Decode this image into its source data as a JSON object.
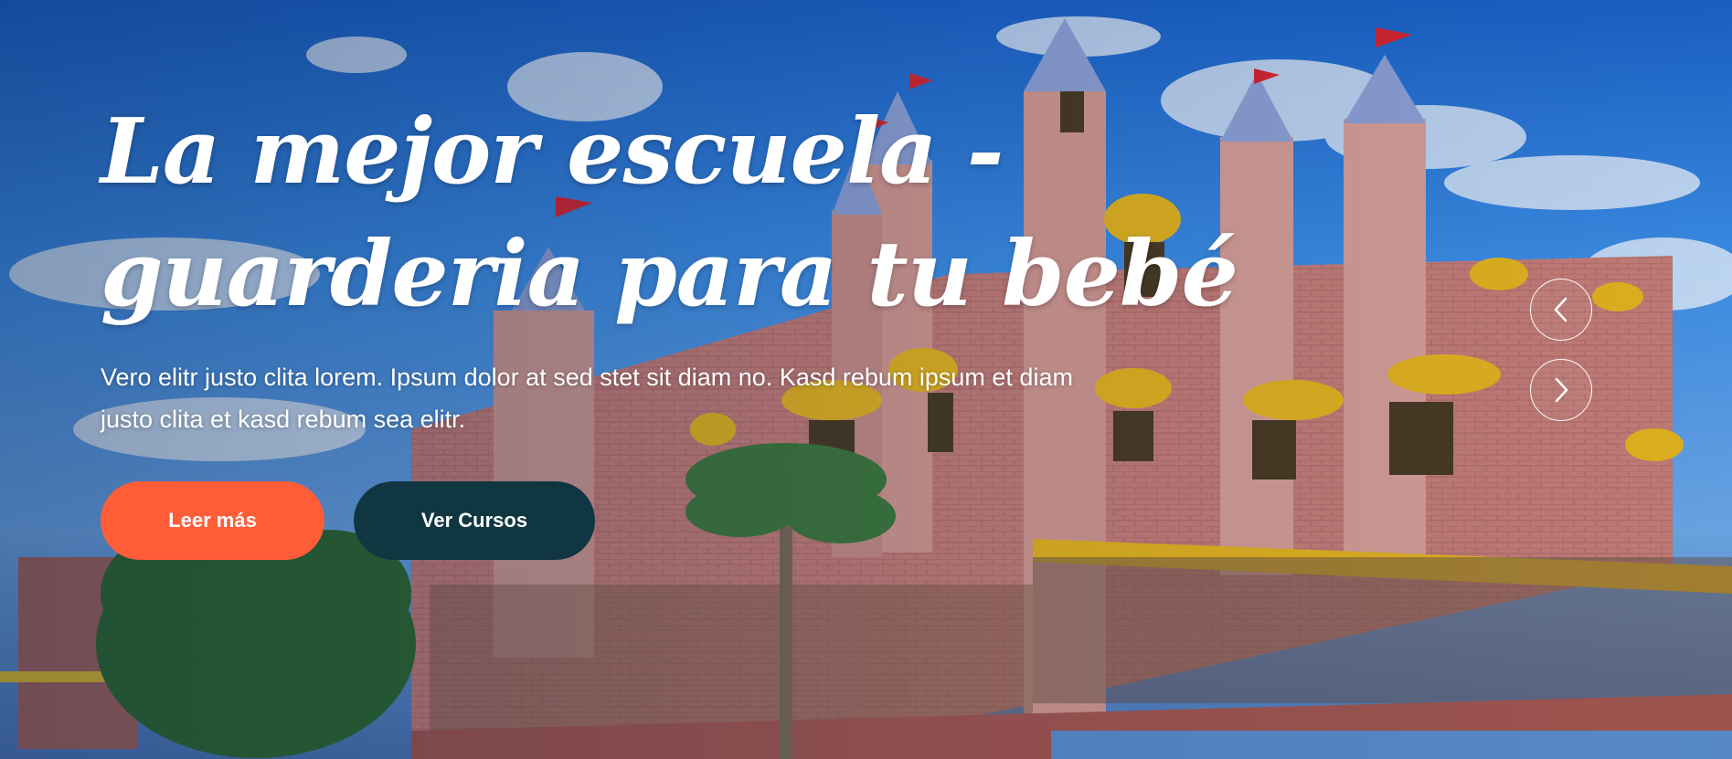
{
  "hero": {
    "headline_line1": "La mejor escuela -",
    "headline_line2": "guarderia para tu bebé",
    "description": "Vero elitr justo clita lorem. Ipsum dolor at sed stet sit diam no. Kasd rebum ipsum et diam justo clita et kasd rebum sea elitr.",
    "primary_button": "Leer más",
    "secondary_button": "Ver Cursos"
  },
  "carousel": {
    "prev_icon": "chevron-left-icon",
    "next_icon": "chevron-right-icon"
  },
  "colors": {
    "primary": "#fe5d37",
    "secondary": "#103741",
    "text": "#ffffff"
  }
}
